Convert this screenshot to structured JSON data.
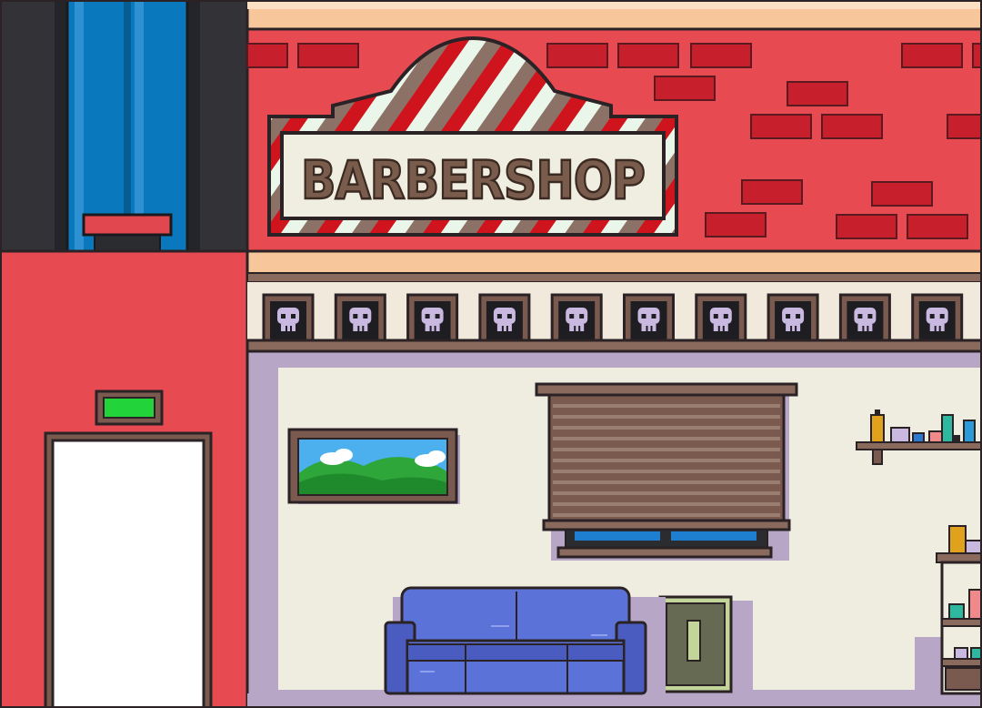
{
  "scene": {
    "shop_sign": {
      "text": "BARBERSHOP"
    },
    "skull_frame_count": 10,
    "elevator_indicator": {
      "state": "on",
      "color": "#22d43a"
    },
    "colors": {
      "brick_wall": "#e84a52",
      "brick": "#c81f2c",
      "outline": "#2a2225",
      "interior_wall": "#efece0",
      "interior_shadow": "#b8a6c6",
      "trim": "#f7c79b",
      "sofa": "#5b73d8",
      "elevator_shaft": "#0a78bc",
      "sign_stripe_red": "#d0141e",
      "sign_stripe_brown": "#8c7266",
      "sign_stripe_cream": "#eaf6ea"
    },
    "elements": [
      "elevator-shaft",
      "elevator-door",
      "barbershop-sign",
      "skull-frames",
      "landscape-painting",
      "window-blinds",
      "sofa",
      "light-switch",
      "shelf-with-bottles",
      "display-cabinet"
    ]
  }
}
